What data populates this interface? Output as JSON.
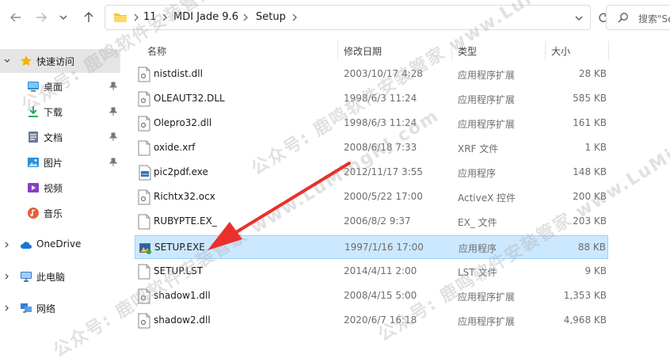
{
  "address": {
    "crumbs": [
      "11",
      "MDI Jade 9.6",
      "Setup"
    ]
  },
  "search": {
    "placeholder": "搜索\"Se"
  },
  "sidebar": {
    "items": [
      {
        "label": "快速访问",
        "icon": "star-icon"
      },
      {
        "label": "桌面",
        "icon": "desktop-icon"
      },
      {
        "label": "下载",
        "icon": "download-icon"
      },
      {
        "label": "文档",
        "icon": "document-icon"
      },
      {
        "label": "图片",
        "icon": "picture-icon"
      },
      {
        "label": "视频",
        "icon": "video-icon"
      },
      {
        "label": "音乐",
        "icon": "music-icon"
      },
      {
        "label": "OneDrive",
        "icon": "cloud-icon"
      },
      {
        "label": "此电脑",
        "icon": "computer-icon"
      },
      {
        "label": "网络",
        "icon": "network-icon"
      }
    ]
  },
  "columns": {
    "name": "名称",
    "date": "修改日期",
    "type": "类型",
    "size": "大小"
  },
  "files": [
    {
      "name": "nistdist.dll",
      "date": "2003/10/17 4:28",
      "type": "应用程序扩展",
      "size": "28 KB",
      "icon": "dll-file-icon"
    },
    {
      "name": "OLEAUT32.DLL",
      "date": "1998/6/3 11:24",
      "type": "应用程序扩展",
      "size": "585 KB",
      "icon": "dll-file-icon"
    },
    {
      "name": "Olepro32.dll",
      "date": "1998/6/3 11:24",
      "type": "应用程序扩展",
      "size": "161 KB",
      "icon": "dll-file-icon"
    },
    {
      "name": "oxide.xrf",
      "date": "2008/6/18 7:33",
      "type": "XRF 文件",
      "size": "1 KB",
      "icon": "blank-file-icon"
    },
    {
      "name": "pic2pdf.exe",
      "date": "2012/11/17 3:55",
      "type": "应用程序",
      "size": "148 KB",
      "icon": "exe-file-icon"
    },
    {
      "name": "Richtx32.ocx",
      "date": "2000/5/22 17:00",
      "type": "ActiveX 控件",
      "size": "200 KB",
      "icon": "dll-file-icon"
    },
    {
      "name": "RUBYPTE.EX_",
      "date": "2006/8/2 9:37",
      "type": "EX_ 文件",
      "size": "203 KB",
      "icon": "blank-file-icon"
    },
    {
      "name": "SETUP.EXE",
      "date": "1997/1/16 17:00",
      "type": "应用程序",
      "size": "88 KB",
      "icon": "setup-exe-icon",
      "selected": true
    },
    {
      "name": "SETUP.LST",
      "date": "2014/4/11 2:00",
      "type": "LST 文件",
      "size": "9 KB",
      "icon": "blank-file-icon"
    },
    {
      "name": "shadow1.dll",
      "date": "2008/4/15 5:00",
      "type": "应用程序扩展",
      "size": "1,353 KB",
      "icon": "dll-file-icon"
    },
    {
      "name": "shadow2.dll",
      "date": "2020/6/7 16:18",
      "type": "应用程序扩展",
      "size": "4,968 KB",
      "icon": "dll-file-icon"
    }
  ],
  "watermark": "公众号: 鹿鸣软件安装管家 www.LuMingRJ.com",
  "colors": {
    "selection": "#cce8ff",
    "selection_border": "#99d1ff",
    "arrow": "#e8312a",
    "sidebar_selected": "#e5e5e5"
  }
}
